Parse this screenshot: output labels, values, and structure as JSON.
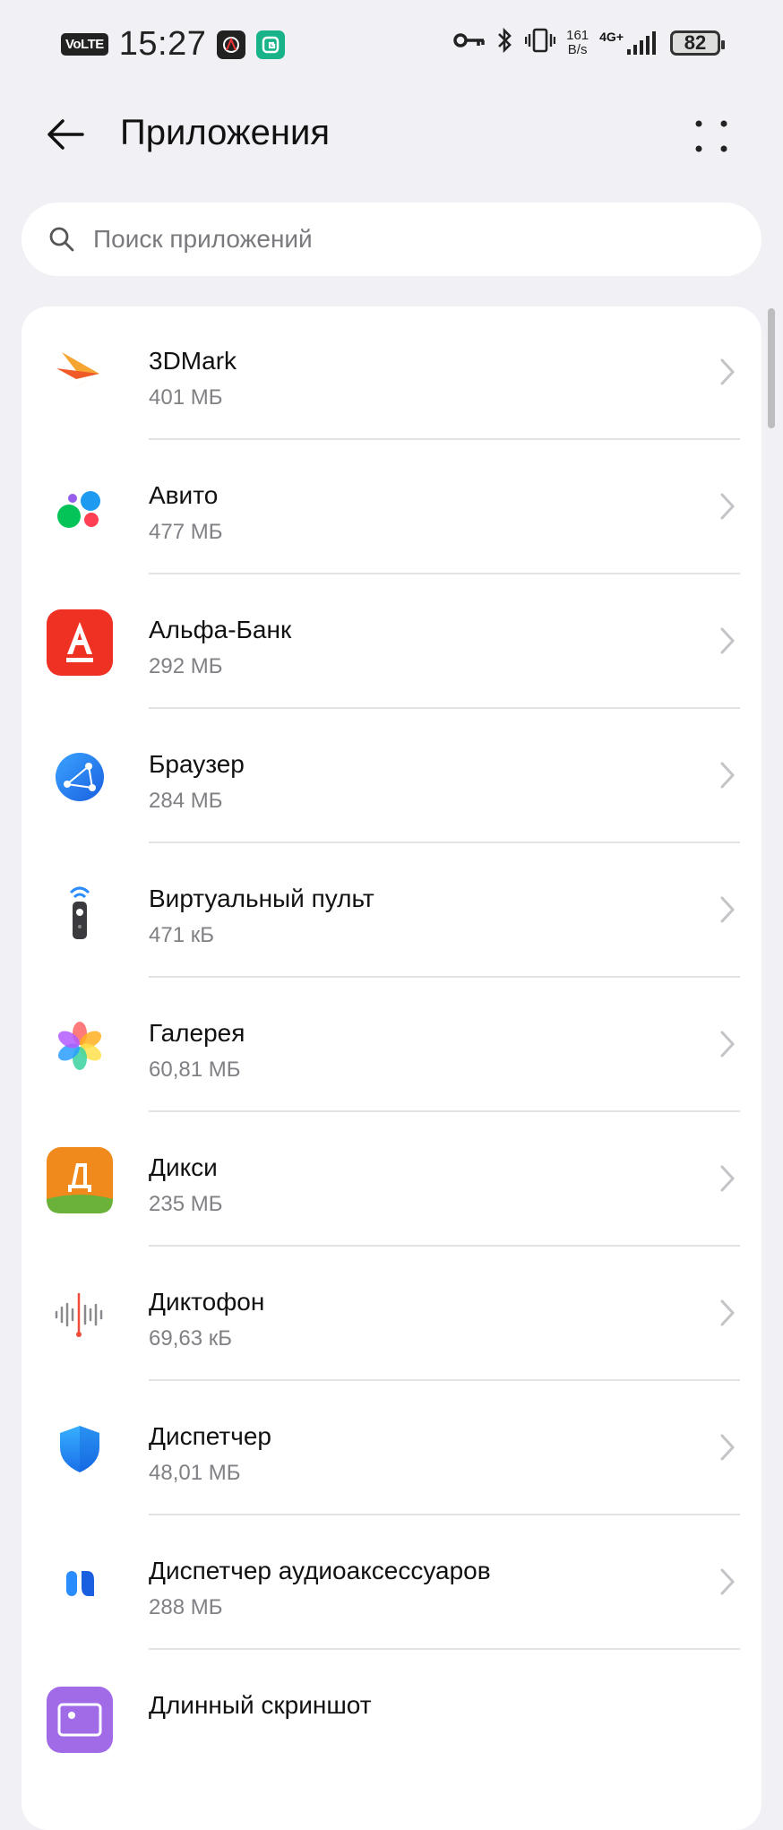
{
  "status_bar": {
    "volte": "VoLTE",
    "time": "15:27",
    "net_speed_value": "161",
    "net_speed_unit": "B/s",
    "network": "4G+",
    "battery": "82"
  },
  "header": {
    "title": "Приложения"
  },
  "search": {
    "placeholder": "Поиск приложений"
  },
  "apps": [
    {
      "name": "3DMark",
      "size": "401 МБ",
      "icon": "3dmark-icon"
    },
    {
      "name": "Авито",
      "size": "477 МБ",
      "icon": "avito-icon"
    },
    {
      "name": "Альфа-Банк",
      "size": "292 МБ",
      "icon": "alfa-bank-icon"
    },
    {
      "name": "Браузер",
      "size": "284 МБ",
      "icon": "browser-icon"
    },
    {
      "name": "Виртуальный пульт",
      "size": "471 кБ",
      "icon": "virtual-remote-icon"
    },
    {
      "name": "Галерея",
      "size": "60,81 МБ",
      "icon": "gallery-icon"
    },
    {
      "name": "Дикси",
      "size": "235 МБ",
      "icon": "dixy-icon"
    },
    {
      "name": "Диктофон",
      "size": "69,63 кБ",
      "icon": "recorder-icon"
    },
    {
      "name": "Диспетчер",
      "size": "48,01 МБ",
      "icon": "optimizer-icon"
    },
    {
      "name": "Диспетчер аудиоаксессуаров",
      "size": "288 МБ",
      "icon": "audio-accessories-icon"
    },
    {
      "name": "Длинный скриншот",
      "size": "",
      "icon": "long-screenshot-icon"
    }
  ],
  "colors": {
    "background": "#f1f1f5",
    "card": "#ffffff",
    "secondary_text": "#808085",
    "alfa_red": "#ef3124",
    "dixy_orange": "#f08a1c",
    "dixy_green": "#6ab23a"
  }
}
